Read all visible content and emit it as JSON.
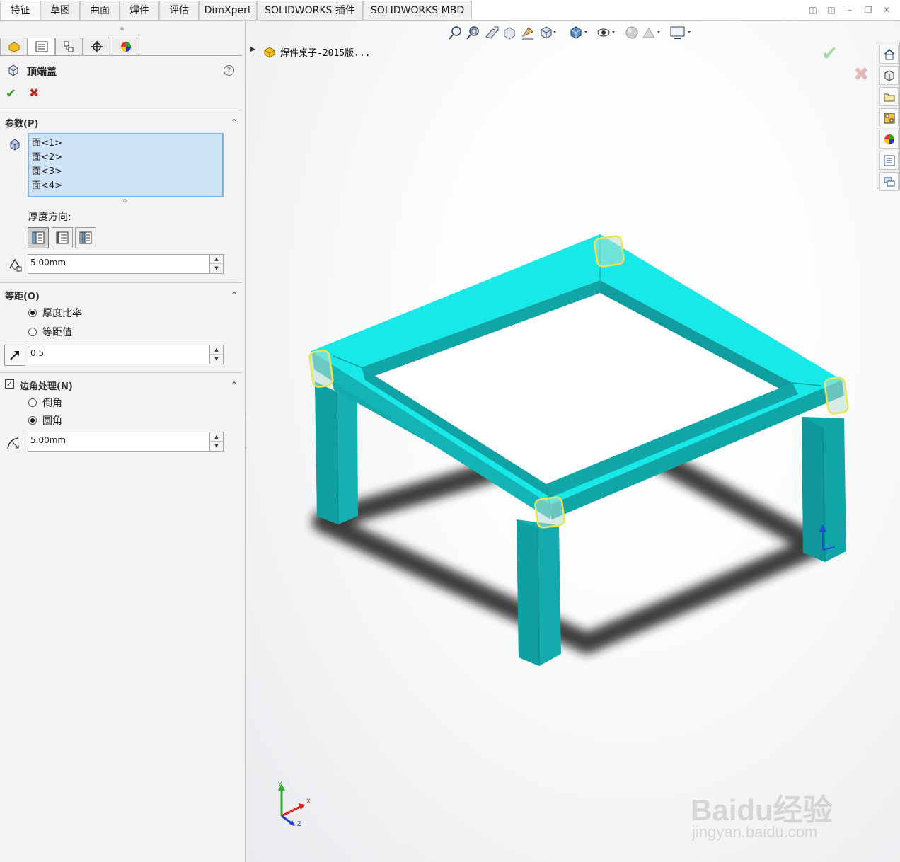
{
  "tabs": [
    "特征",
    "草图",
    "曲面",
    "焊件",
    "评估",
    "DimXpert",
    "SOLIDWORKS 插件",
    "SOLIDWORKS MBD"
  ],
  "property_manager": {
    "title": "顶端盖",
    "sections": {
      "parameters": {
        "title": "参数(P)",
        "faces": [
          "面<1>",
          "面<2>",
          "面<3>",
          "面<4>"
        ],
        "thickness_direction_label": "厚度方向:",
        "thickness_value": "5.00mm"
      },
      "offset": {
        "title": "等距(O)",
        "option_ratio": "厚度比率",
        "option_value": "等距值",
        "ratio_value": "0.5"
      },
      "corner": {
        "title": "边角处理(N)",
        "option_chamfer": "倒角",
        "option_fillet": "圆角",
        "fillet_value": "5.00mm"
      }
    }
  },
  "feature_tree": {
    "root_label": "焊件桌子-2015版..."
  },
  "triad": {
    "x": "X",
    "y": "Y",
    "z": "Z"
  },
  "watermark": {
    "main": "Baidu经验",
    "sub": "jingyan.baidu.com"
  },
  "colors": {
    "model": "#19e6e6",
    "model_dark": "#11b4b6",
    "highlight": "#e6e65a",
    "ok": "#3a9a2a",
    "cancel": "#cc2222"
  }
}
